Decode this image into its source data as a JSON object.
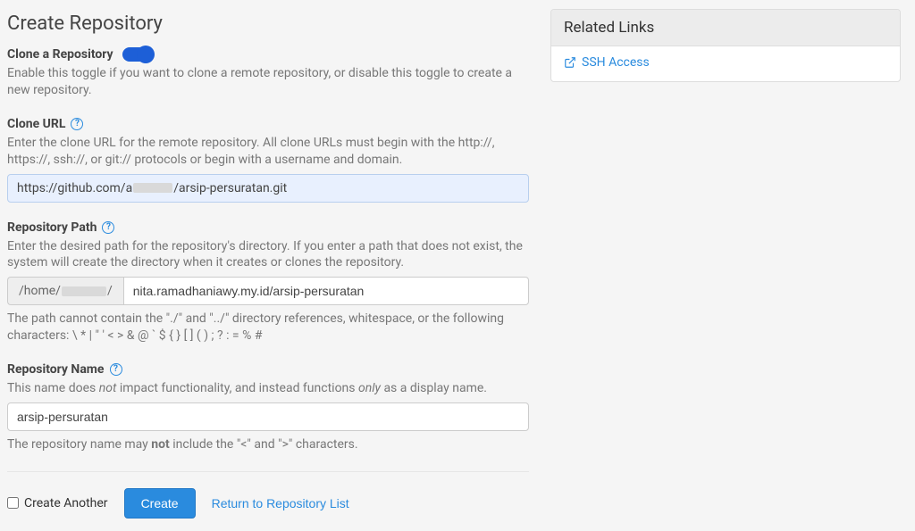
{
  "page": {
    "title": "Create Repository"
  },
  "clone_toggle": {
    "label": "Clone a Repository",
    "desc": "Enable this toggle if you want to clone a remote repository, or disable this toggle to create a new repository.",
    "on": true
  },
  "clone_url": {
    "label": "Clone URL",
    "desc": "Enter the clone URL for the remote repository. All clone URLs must begin with the http://, https://, ssh://, or git:// protocols or begin with a username and domain.",
    "value_prefix": "https://github.com/a",
    "value_suffix": "/arsip-persuratan.git"
  },
  "repo_path": {
    "label": "Repository Path",
    "desc": "Enter the desired path for the repository's directory. If you enter a path that does not exist, the system will create the directory when it creates or clones the repository.",
    "prefix_pre": "/home/",
    "prefix_post": "/",
    "value": "nita.ramadhaniawy.my.id/arsip-persuratan",
    "post_desc": "The path cannot contain the \"./\" and \"../\" directory references, whitespace, or the following characters: \\ * | \" ' < > & @ ` $ { } [ ] ( ) ; ? : = % #"
  },
  "repo_name": {
    "label": "Repository Name",
    "desc_pre": "This name does ",
    "desc_em": "not",
    "desc_mid": " impact functionality, and instead functions ",
    "desc_em2": "only",
    "desc_post": " as a display name.",
    "value": "arsip-persuratan",
    "post_pre": "The repository name may ",
    "post_strong": "not",
    "post_post": " include the \"<\" and \">\" characters."
  },
  "footer": {
    "create_another": "Create Another",
    "create": "Create",
    "return": "Return to Repository List"
  },
  "sidebar": {
    "title": "Related Links",
    "links": [
      {
        "label": "SSH Access"
      }
    ]
  }
}
